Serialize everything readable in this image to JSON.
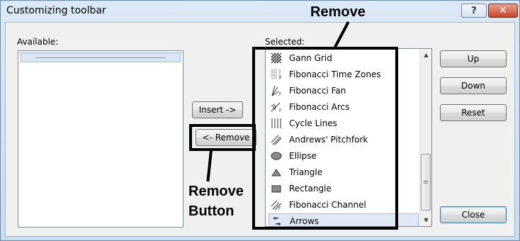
{
  "window": {
    "title": "Customizing toolbar",
    "help_label": "?",
    "close_label": "✕"
  },
  "available": {
    "label": "Available:"
  },
  "buttons": {
    "insert": "Insert ->",
    "remove": "<- Remove",
    "up": "Up",
    "down": "Down",
    "reset": "Reset",
    "close": "Close"
  },
  "selected": {
    "label": "Selected:",
    "items": [
      {
        "label": "Gann Grid",
        "icon": "gann-grid-icon"
      },
      {
        "label": "Fibonacci Time Zones",
        "icon": "fibonacci-time-zones-icon"
      },
      {
        "label": "Fibonacci Fan",
        "icon": "fibonacci-fan-icon"
      },
      {
        "label": "Fibonacci Arcs",
        "icon": "fibonacci-arcs-icon"
      },
      {
        "label": "Cycle Lines",
        "icon": "cycle-lines-icon"
      },
      {
        "label": "Andrews' Pitchfork",
        "icon": "pitchfork-icon"
      },
      {
        "label": "Ellipse",
        "icon": "ellipse-icon"
      },
      {
        "label": "Triangle",
        "icon": "triangle-icon"
      },
      {
        "label": "Rectangle",
        "icon": "rectangle-icon"
      },
      {
        "label": "Fibonacci Channel",
        "icon": "fibonacci-channel-icon"
      },
      {
        "label": "Arrows",
        "icon": "arrows-icon",
        "selected": true
      }
    ]
  },
  "annotations": {
    "top": "Remove",
    "bottom_line1": "Remove",
    "bottom_line2": "Button"
  }
}
